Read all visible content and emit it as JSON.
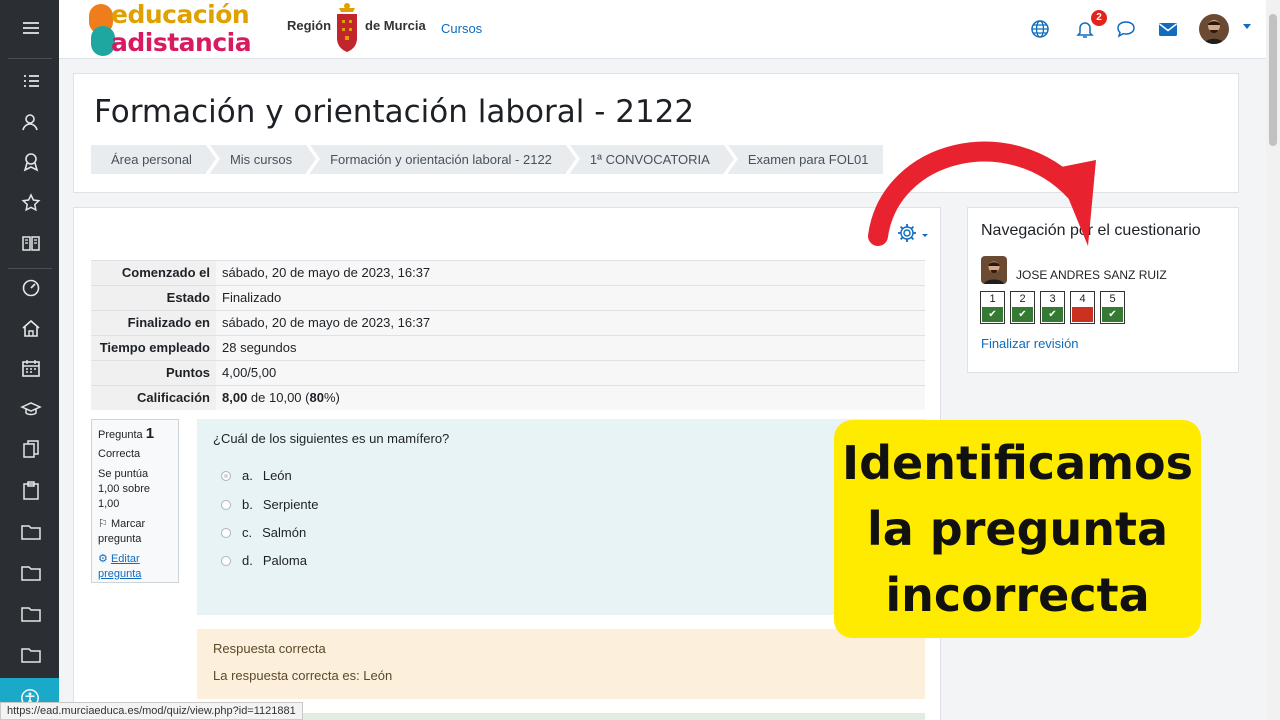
{
  "navbar": {
    "logo_line1": "educación",
    "logo_line2": "adistancia",
    "region_left": "Región",
    "region_right": "de Murcia",
    "cursos": "Cursos",
    "notifications_count": "2"
  },
  "header": {
    "title": "Formación y orientación laboral - 2122",
    "breadcrumb": [
      "Área personal",
      "Mis cursos",
      "Formación y orientación laboral - 2122",
      "1ª CONVOCATORIA",
      "Examen para FOL01"
    ]
  },
  "summary": {
    "rows": [
      {
        "label": "Comenzado el",
        "value": "sábado, 20 de mayo de 2023, 16:37"
      },
      {
        "label": "Estado",
        "value": "Finalizado"
      },
      {
        "label": "Finalizado en",
        "value": "sábado, 20 de mayo de 2023, 16:37"
      },
      {
        "label": "Tiempo empleado",
        "value": "28 segundos"
      },
      {
        "label": "Puntos",
        "value": "4,00/5,00"
      }
    ],
    "grade_label": "Calificación",
    "grade_value": "8,00",
    "grade_mid": " de 10,00 (",
    "grade_percent": "80",
    "grade_end": "%)"
  },
  "question": {
    "label": "Pregunta",
    "number": "1",
    "status": "Correcta",
    "score": "Se puntúa 1,00 sobre 1,00",
    "flag": "Marcar pregunta",
    "edit": "Editar pregunta",
    "text": "¿Cuál de los siguientes es un mamífero?",
    "options": [
      {
        "letter": "a.",
        "text": "León",
        "checked": true
      },
      {
        "letter": "b.",
        "text": "Serpiente",
        "checked": false
      },
      {
        "letter": "c.",
        "text": "Salmón",
        "checked": false
      },
      {
        "letter": "d.",
        "text": "Paloma",
        "checked": false
      }
    ],
    "feedback_title": "Respuesta correcta",
    "feedback_text": "La respuesta correcta es: León"
  },
  "quiz_nav": {
    "title": "Navegación por el cuestionario",
    "student": "JOSE ANDRES SANZ RUIZ",
    "questions": [
      {
        "num": "1",
        "state": "correct"
      },
      {
        "num": "2",
        "state": "correct"
      },
      {
        "num": "3",
        "state": "correct"
      },
      {
        "num": "4",
        "state": "incorrect"
      },
      {
        "num": "5",
        "state": "correct"
      }
    ],
    "finish": "Finalizar revisión"
  },
  "callout": {
    "line1": "Identificamos",
    "line2": "la pregunta",
    "line3": "incorrecta"
  },
  "status_url": "https://ead.murciaeduca.es/mod/quiz/view.php?id=1121881",
  "colors": {
    "accent": "#0f6cbf",
    "correct": "#357a32",
    "incorrect": "#ca3120",
    "callout": "#ffeb00",
    "arrow": "#e8232f"
  }
}
